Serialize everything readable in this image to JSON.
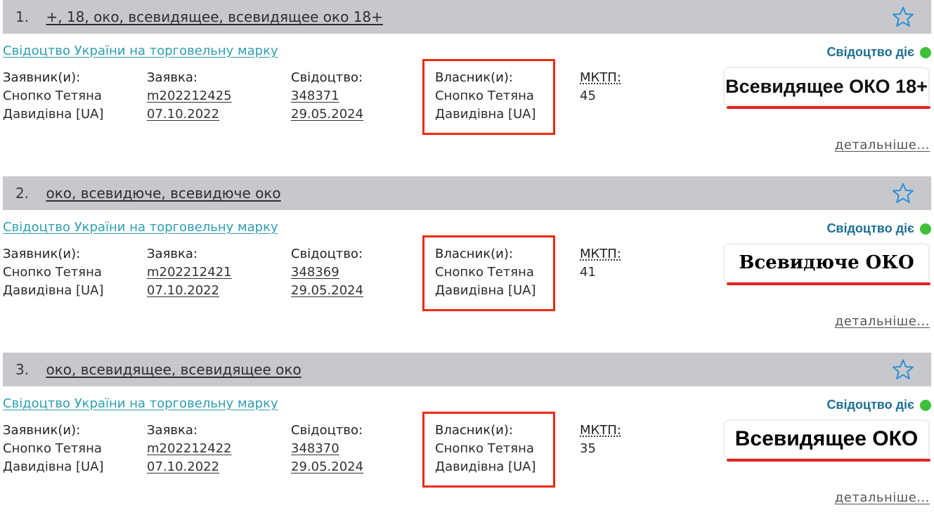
{
  "labels": {
    "applicant": "Заявник(и):",
    "application": "Заявка:",
    "certificate": "Свідоцтво:",
    "owner": "Власник(и):",
    "class": "МКТП:",
    "more": "детальніше..."
  },
  "colors": {
    "header_bg": "#c6c8cc",
    "link_teal": "#2f9eb0",
    "status_blue": "#1e6f97",
    "status_dot": "#3fc03a",
    "highlight_red": "#ee2b15",
    "star_blue": "#2b8fd6"
  },
  "records": [
    {
      "number": "1.",
      "title": "+, 18, око, всевидящее, всевидящее око 18+",
      "cert_type": "Свідоцтво України на торговельну марку",
      "status": "Свідоцтво діє",
      "applicant": [
        "Снопко Тетяна",
        "Давидівна [UA]"
      ],
      "application_no": "m202212425",
      "application_date": "07.10.2022",
      "certificate_no": "348371",
      "certificate_date": "29.05.2024",
      "owner": [
        "Снопко Тетяна",
        "Давидівна [UA]"
      ],
      "class": "45",
      "mark_text": "Всевидящее ОКО 18+",
      "icon": "star-outline-icon"
    },
    {
      "number": "2.",
      "title": "око, всевидюче, всевидюче око",
      "cert_type": "Свідоцтво України на торговельну марку",
      "status": "Свідоцтво діє",
      "applicant": [
        "Снопко Тетяна",
        "Давидівна [UA]"
      ],
      "application_no": "m202212421",
      "application_date": "07.10.2022",
      "certificate_no": "348369",
      "certificate_date": "29.05.2024",
      "owner": [
        "Снопко Тетяна",
        "Давидівна [UA]"
      ],
      "class": "41",
      "mark_text": "Всевидюче ОКО",
      "icon": "star-outline-icon"
    },
    {
      "number": "3.",
      "title": "око, всевидящее, всевидящее око",
      "cert_type": "Свідоцтво України на торговельну марку",
      "status": "Свідоцтво діє",
      "applicant": [
        "Снопко Тетяна",
        "Давидівна [UA]"
      ],
      "application_no": "m202212422",
      "application_date": "07.10.2022",
      "certificate_no": "348370",
      "certificate_date": "29.05.2024",
      "owner": [
        "Снопко Тетяна",
        "Давидівна [UA]"
      ],
      "class": "35",
      "mark_text": "Всевидящее ОКО",
      "icon": "star-outline-icon"
    }
  ]
}
